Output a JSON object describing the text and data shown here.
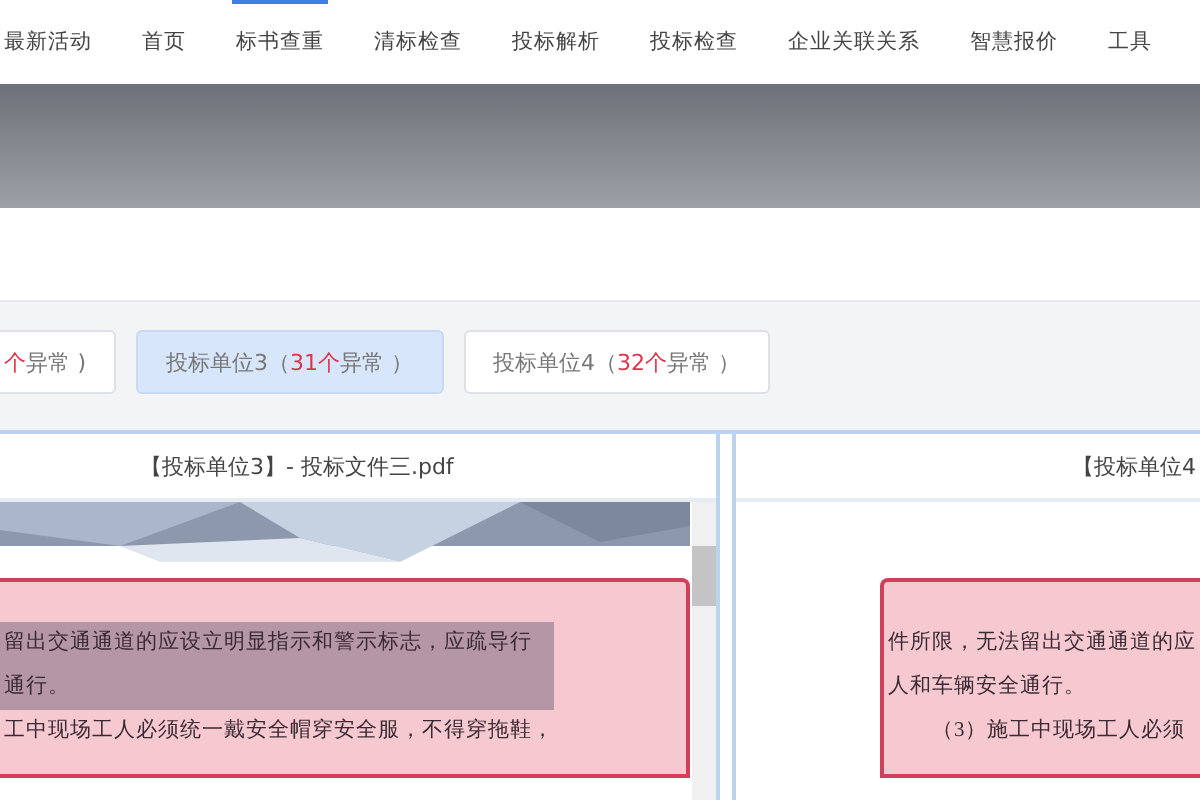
{
  "nav": [
    {
      "label": "最新活动",
      "selected": false
    },
    {
      "label": "首页",
      "selected": false
    },
    {
      "label": "标书查重",
      "selected": true
    },
    {
      "label": "清标检查",
      "selected": false
    },
    {
      "label": "投标解析",
      "selected": false
    },
    {
      "label": "投标检查",
      "selected": false
    },
    {
      "label": "企业关联关系",
      "selected": false
    },
    {
      "label": "智慧报价",
      "selected": false
    },
    {
      "label": "工具",
      "selected": false
    }
  ],
  "bidders": [
    {
      "count": "个",
      "suffix": "异常 )",
      "selected": false
    },
    {
      "label": "投标单位3",
      "open": "（",
      "count": "31个",
      "suffix": "异常 ）",
      "selected": true
    },
    {
      "label": "投标单位4",
      "open": "（",
      "count": "32个",
      "suffix": "异常 ）",
      "selected": false
    }
  ],
  "panels": [
    {
      "title": "【投标单位3】- 投标文件三.pdf",
      "kind": "left",
      "lines": [
        {
          "text": "留出交通通道的应设立明显指示和警示标志，应疏导行",
          "highlighted": true
        },
        {
          "text": "通行。",
          "highlighted": true
        },
        {
          "text": "工中现场工人必须统一戴安全帽穿安全服，不得穿拖鞋，",
          "highlighted": false
        }
      ]
    },
    {
      "title": "【投标单位4",
      "kind": "right",
      "lines": [
        {
          "text": "件所限，无法留出交通通道的应",
          "highlighted": false
        },
        {
          "text": "人和车辆安全通行。",
          "highlighted": false
        },
        {
          "text": "　　（3）施工中现场工人必须",
          "highlighted": false
        }
      ]
    }
  ]
}
